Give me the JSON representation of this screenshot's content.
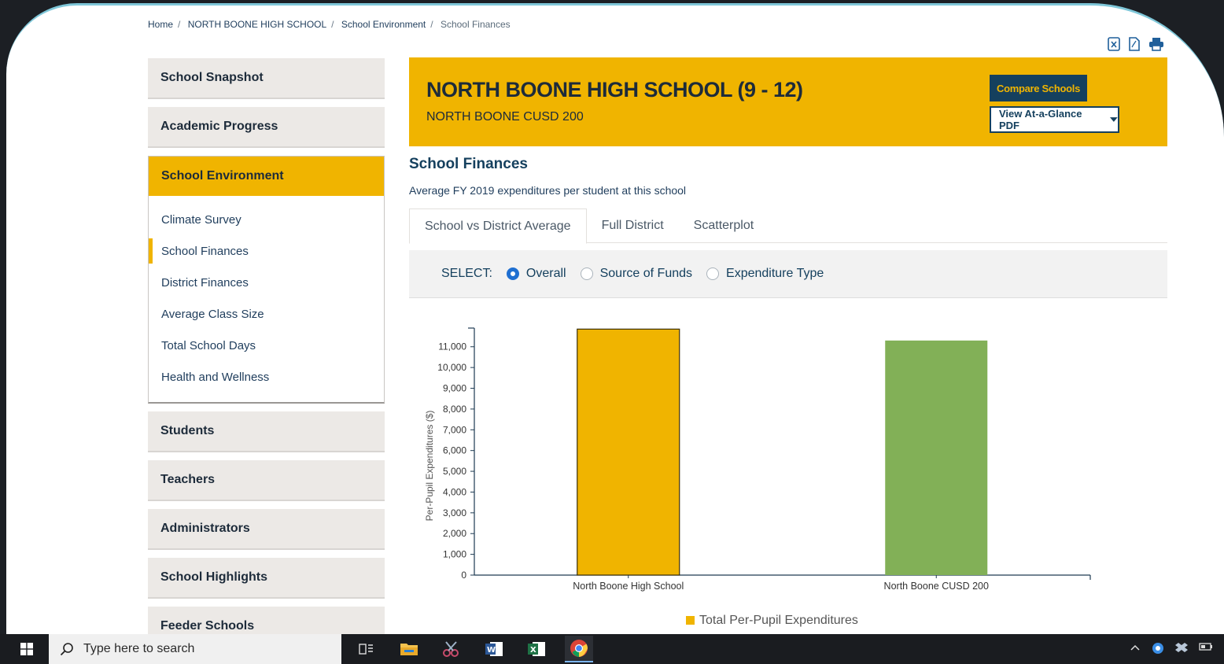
{
  "breadcrumb": [
    "Home",
    "NORTH BOONE HIGH SCHOOL",
    "School Environment",
    "School Finances"
  ],
  "export_icons": [
    "excel-icon",
    "pdf-icon",
    "print-icon"
  ],
  "sidebar": {
    "items_top": [
      "School Snapshot",
      "Academic Progress"
    ],
    "active_group": {
      "label": "School Environment",
      "sub": [
        "Climate Survey",
        "School Finances",
        "District Finances",
        "Average Class Size",
        "Total School Days",
        "Health and Wellness"
      ],
      "active_sub": "School Finances"
    },
    "items_bottom": [
      "Students",
      "Teachers",
      "Administrators",
      "School Highlights",
      "Feeder Schools"
    ]
  },
  "banner": {
    "school": "NORTH BOONE HIGH SCHOOL (9 - 12)",
    "district": "NORTH BOONE CUSD 200",
    "compare_label": "Compare Schools",
    "pdf_label": "View At-a-Glance PDF"
  },
  "section": {
    "title": "School Finances",
    "subtitle": "Average FY 2019 expenditures per student at this school"
  },
  "tabs": [
    "School vs District Average",
    "Full District",
    "Scatterplot"
  ],
  "select": {
    "label": "SELECT:",
    "options": [
      "Overall",
      "Source of Funds",
      "Expenditure Type"
    ],
    "selected": "Overall"
  },
  "colors": {
    "gold": "#f0b400",
    "green": "#82b057",
    "navy": "#15405e"
  },
  "chart_data": {
    "type": "bar",
    "categories": [
      "North Boone High School",
      "North Boone CUSD 200"
    ],
    "series": [
      {
        "name": "Total Per-Pupil Expenditures",
        "values": [
          11850,
          11300
        ]
      }
    ],
    "bar_colors": [
      "#f0b400",
      "#82b057"
    ],
    "ylabel": "Per-Pupil Expenditures ($)",
    "yticks": [
      "0",
      "1,000",
      "2,000",
      "3,000",
      "4,000",
      "5,000",
      "6,000",
      "7,000",
      "8,000",
      "9,000",
      "10,000",
      "11,000"
    ],
    "ylim": [
      0,
      11900
    ],
    "legend": "bottom"
  },
  "taskbar": {
    "search_placeholder": "Type here to search",
    "apps": [
      "task-view-icon",
      "file-explorer-icon",
      "snipping-tool-icon",
      "word-icon",
      "excel-icon",
      "chrome-icon"
    ]
  }
}
